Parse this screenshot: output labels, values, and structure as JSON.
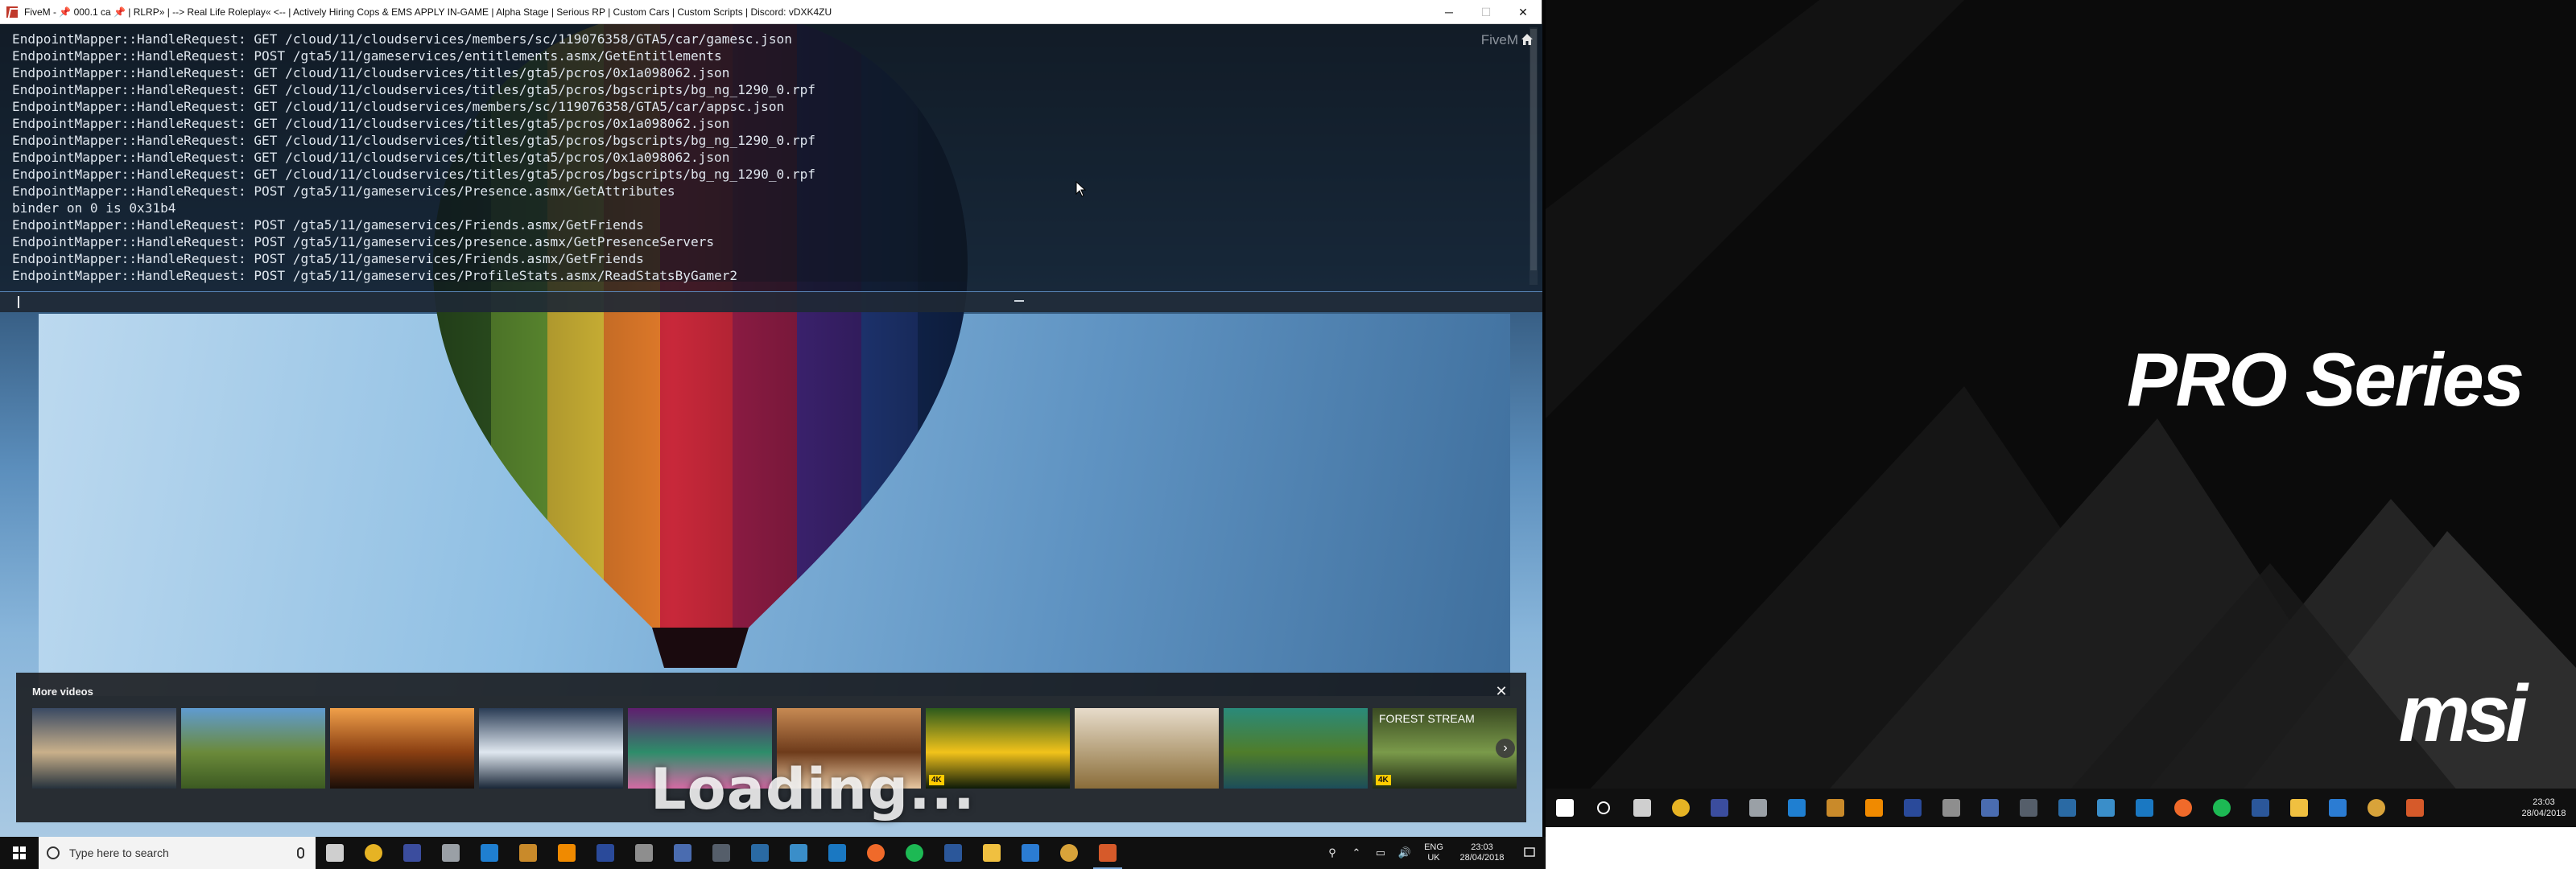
{
  "window": {
    "title": "FiveM - 📌 000.1 ca 📌 | RLRP» | --> Real Life Roleplay« <-- | Actively Hiring Cops & EMS APPLY IN-GAME | Alpha Stage | Serious RP | Custom Cars | Custom Scripts | Discord: vDXK4ZU",
    "minimize": "─",
    "maximize": "☐",
    "close": "✕"
  },
  "console": {
    "lines": [
      "EndpointMapper::HandleRequest: GET /cloud/11/cloudservices/members/sc/119076358/GTA5/car/gamesc.json",
      "EndpointMapper::HandleRequest: POST /gta5/11/gameservices/entitlements.asmx/GetEntitlements",
      "EndpointMapper::HandleRequest: GET /cloud/11/cloudservices/titles/gta5/pcros/0x1a098062.json",
      "EndpointMapper::HandleRequest: GET /cloud/11/cloudservices/titles/gta5/pcros/bgscripts/bg_ng_1290_0.rpf",
      "EndpointMapper::HandleRequest: GET /cloud/11/cloudservices/members/sc/119076358/GTA5/car/appsc.json",
      "EndpointMapper::HandleRequest: GET /cloud/11/cloudservices/titles/gta5/pcros/0x1a098062.json",
      "EndpointMapper::HandleRequest: GET /cloud/11/cloudservices/titles/gta5/pcros/bgscripts/bg_ng_1290_0.rpf",
      "EndpointMapper::HandleRequest: GET /cloud/11/cloudservices/titles/gta5/pcros/0x1a098062.json",
      "EndpointMapper::HandleRequest: GET /cloud/11/cloudservices/titles/gta5/pcros/bgscripts/bg_ng_1290_0.rpf",
      "EndpointMapper::HandleRequest: POST /gta5/11/gameservices/Presence.asmx/GetAttributes",
      "binder on 0 is 0x31b4",
      "EndpointMapper::HandleRequest: POST /gta5/11/gameservices/Friends.asmx/GetFriends",
      "EndpointMapper::HandleRequest: POST /gta5/11/gameservices/presence.asmx/GetPresenceServers",
      "EndpointMapper::HandleRequest: POST /gta5/11/gameservices/Friends.asmx/GetFriends",
      "EndpointMapper::HandleRequest: POST /gta5/11/gameservices/ProfileStats.asmx/ReadStatsByGamer2"
    ],
    "input_value": "",
    "watermark": "FiveM"
  },
  "more_videos": {
    "title": "More videos",
    "close_icon": "close-icon",
    "next_icon": "chevron-right-icon",
    "thumbnails": [
      {
        "label": "",
        "badge": "",
        "colors": [
          "#3a4a63",
          "#c9b08a",
          "#26323d"
        ]
      },
      {
        "label": "",
        "badge": "",
        "colors": [
          "#5f9bd1",
          "#6b8a3a",
          "#3c5a22"
        ]
      },
      {
        "label": "",
        "badge": "",
        "colors": [
          "#f0a04a",
          "#8a3f12",
          "#1a0e08"
        ]
      },
      {
        "label": "",
        "badge": "",
        "colors": [
          "#2a3c55",
          "#dfe7ef",
          "#1a2738"
        ]
      },
      {
        "label": "",
        "badge": "",
        "colors": [
          "#5f1e6e",
          "#2e8d6a",
          "#d46aa4"
        ]
      },
      {
        "label": "",
        "badge": "",
        "colors": [
          "#c78a53",
          "#6e3b1b",
          "#e8c8a2"
        ]
      },
      {
        "label": "",
        "badge": "4K",
        "colors": [
          "#2c5a1c",
          "#f2c31b",
          "#0d1a08"
        ]
      },
      {
        "label": "",
        "badge": "",
        "colors": [
          "#e7dccb",
          "#b5a07a",
          "#8a6d3a"
        ]
      },
      {
        "label": "",
        "badge": "",
        "colors": [
          "#2a8a7a",
          "#4f7d2a",
          "#1c4d5a"
        ]
      },
      {
        "label": "FOREST STREAM",
        "badge": "4K",
        "colors": [
          "#3a4a22",
          "#7a9a4a",
          "#202a14"
        ]
      }
    ]
  },
  "loading_text": "Loading...",
  "taskbar_left": {
    "search_placeholder": "Type here to search",
    "apps": [
      {
        "name": "task-view-icon",
        "color": "#cfcfcf",
        "active": false
      },
      {
        "name": "chrome-icon",
        "color": "#e6b324",
        "active": false
      },
      {
        "name": "media-player-icon",
        "color": "#3b4d9e",
        "active": false
      },
      {
        "name": "steam-alt-icon",
        "color": "#9aa0a6",
        "active": false
      },
      {
        "name": "vscode-icon",
        "color": "#1f7fd1",
        "active": false
      },
      {
        "name": "game-icon",
        "color": "#c98a2a",
        "active": false
      },
      {
        "name": "vlc-icon",
        "color": "#f08a00",
        "active": false
      },
      {
        "name": "photoshop-icon",
        "color": "#2a4a9a",
        "active": false
      },
      {
        "name": "snip-icon",
        "color": "#8e8e8e",
        "active": false
      },
      {
        "name": "monitor-icon",
        "color": "#4a6cb0",
        "active": false
      },
      {
        "name": "obs-icon",
        "color": "#555e6a",
        "active": false
      },
      {
        "name": "steam-icon",
        "color": "#2a6aa4",
        "active": false
      },
      {
        "name": "controller-icon",
        "color": "#3a8ec9",
        "active": false
      },
      {
        "name": "outlook-icon",
        "color": "#1a78c2",
        "active": false
      },
      {
        "name": "origin-icon",
        "color": "#f06a2a",
        "active": false
      },
      {
        "name": "spotify-icon",
        "color": "#1db954",
        "active": false
      },
      {
        "name": "word-icon",
        "color": "#2b579a",
        "active": false
      },
      {
        "name": "explorer-icon",
        "color": "#f0c040",
        "active": false
      },
      {
        "name": "mail-icon",
        "color": "#2b7cd3",
        "active": false
      },
      {
        "name": "chrome-alt-icon",
        "color": "#d8a33a",
        "active": false
      },
      {
        "name": "fivem-icon",
        "color": "#d65a2a",
        "active": true
      }
    ],
    "tray": {
      "lang_1": "ENG",
      "lang_2": "UK",
      "time": "23:03",
      "date": "28/04/2018"
    }
  },
  "right_monitor": {
    "brand_line": "PRO Series",
    "brand_logo": "msi",
    "taskbar_apps": [
      {
        "name": "windows-start-icon",
        "color": "#ffffff"
      },
      {
        "name": "cortana-icon",
        "color": "#ffffff"
      },
      {
        "name": "task-view-icon",
        "color": "#cfcfcf"
      },
      {
        "name": "chrome-icon",
        "color": "#e6b324"
      },
      {
        "name": "media-player-icon",
        "color": "#3b4d9e"
      },
      {
        "name": "steam-alt-icon",
        "color": "#9aa0a6"
      },
      {
        "name": "vscode-icon",
        "color": "#1f7fd1"
      },
      {
        "name": "game-icon",
        "color": "#c98a2a"
      },
      {
        "name": "vlc-icon",
        "color": "#f08a00"
      },
      {
        "name": "photoshop-icon",
        "color": "#2a4a9a"
      },
      {
        "name": "snip-icon",
        "color": "#8e8e8e"
      },
      {
        "name": "monitor-icon",
        "color": "#4a6cb0"
      },
      {
        "name": "obs-icon",
        "color": "#555e6a"
      },
      {
        "name": "steam-icon",
        "color": "#2a6aa4"
      },
      {
        "name": "controller-icon",
        "color": "#3a8ec9"
      },
      {
        "name": "outlook-icon",
        "color": "#1a78c2"
      },
      {
        "name": "origin-icon",
        "color": "#f06a2a"
      },
      {
        "name": "spotify-icon",
        "color": "#1db954"
      },
      {
        "name": "word-icon",
        "color": "#2b579a"
      },
      {
        "name": "explorer-icon",
        "color": "#f0c040"
      },
      {
        "name": "mail-icon",
        "color": "#2b7cd3"
      },
      {
        "name": "chrome-alt-icon",
        "color": "#d8a33a"
      },
      {
        "name": "fivem-icon",
        "color": "#d65a2a"
      }
    ],
    "tray_time": "23:03",
    "tray_date": "28/04/2018"
  }
}
